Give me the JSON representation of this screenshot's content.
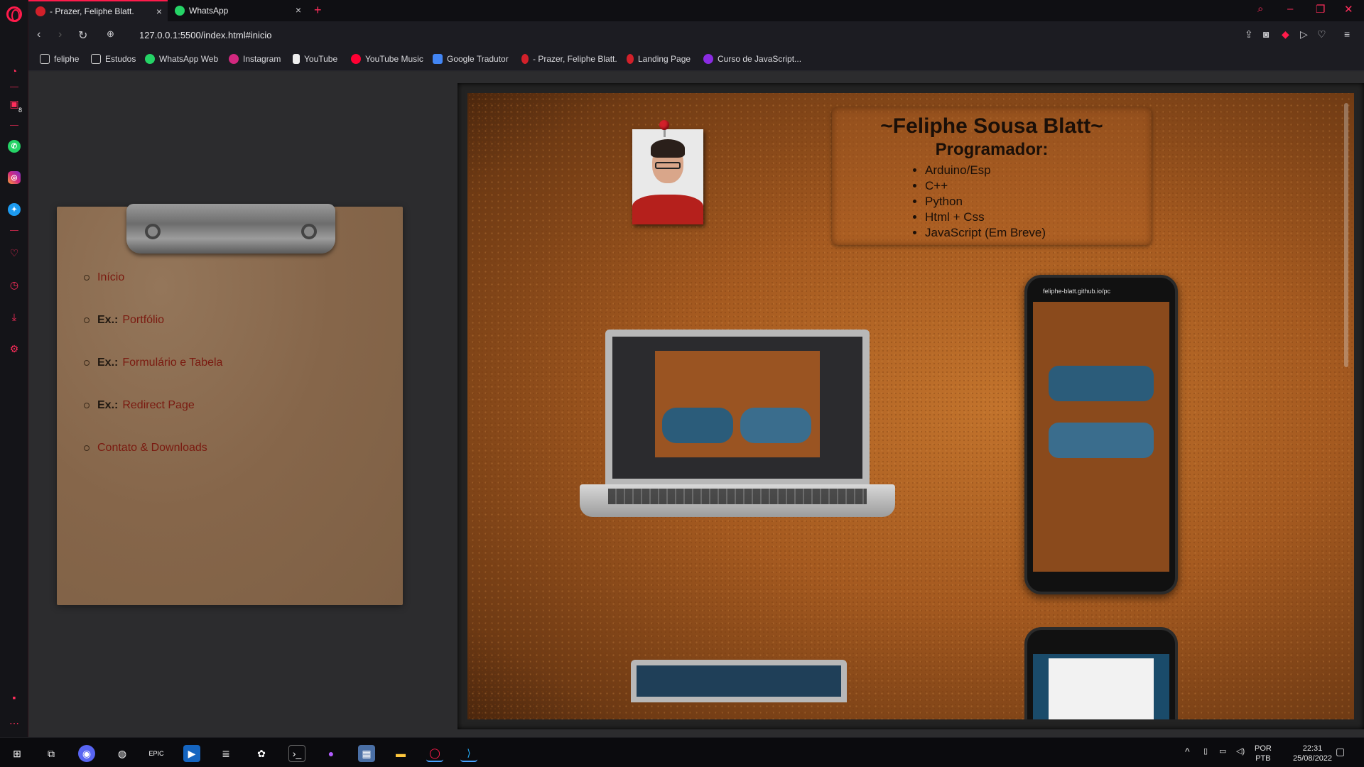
{
  "browser": {
    "tabs": [
      {
        "label": "- Prazer, Feliphe Blatt."
      },
      {
        "label": "WhatsApp"
      }
    ],
    "url": "127.0.0.1:5500/index.html#inicio",
    "sidebar_badge": "8"
  },
  "bookmarks": [
    {
      "label": "feliphe",
      "icon": "folder-icon"
    },
    {
      "label": "Estudos",
      "icon": "folder-icon"
    },
    {
      "label": "WhatsApp Web",
      "icon": "whatsapp-icon"
    },
    {
      "label": "Instagram",
      "icon": "instagram-icon"
    },
    {
      "label": "YouTube",
      "icon": "file-icon"
    },
    {
      "label": "YouTube Music",
      "icon": "youtube-music-icon"
    },
    {
      "label": "Google Tradutor",
      "icon": "google-translate-icon"
    },
    {
      "label": "- Prazer, Feliphe Blatt.",
      "icon": "pin-icon"
    },
    {
      "label": "Landing Page",
      "icon": "pin-icon"
    },
    {
      "label": "Curso de JavaScript...",
      "icon": "course-icon"
    }
  ],
  "nav": {
    "items": [
      {
        "prefix": "",
        "label": "Início"
      },
      {
        "prefix": "Ex.:",
        "label": "Portfólio"
      },
      {
        "prefix": "Ex.:",
        "label": "Formulário e Tabela"
      },
      {
        "prefix": "Ex.:",
        "label": "Redirect Page"
      },
      {
        "prefix": "",
        "label": "Contato & Downloads"
      }
    ]
  },
  "profile": {
    "name": "~Feliphe Sousa Blatt~",
    "role": "Programador:",
    "skills": [
      "Arduino/Esp",
      "C++",
      "Python",
      "Html + Css",
      "JavaScript (Em Breve)"
    ]
  },
  "phone": {
    "url": "feliphe-blatt.github.io/pc"
  },
  "taskbar": {
    "lang": "POR",
    "layout": "PTB",
    "time": "22:31",
    "date": "25/08/2022"
  },
  "colors": {
    "accent": "#ff1b4b",
    "link": "#7a1a10",
    "cork": "#a55a20",
    "clipboard": "#8a6a4a"
  }
}
